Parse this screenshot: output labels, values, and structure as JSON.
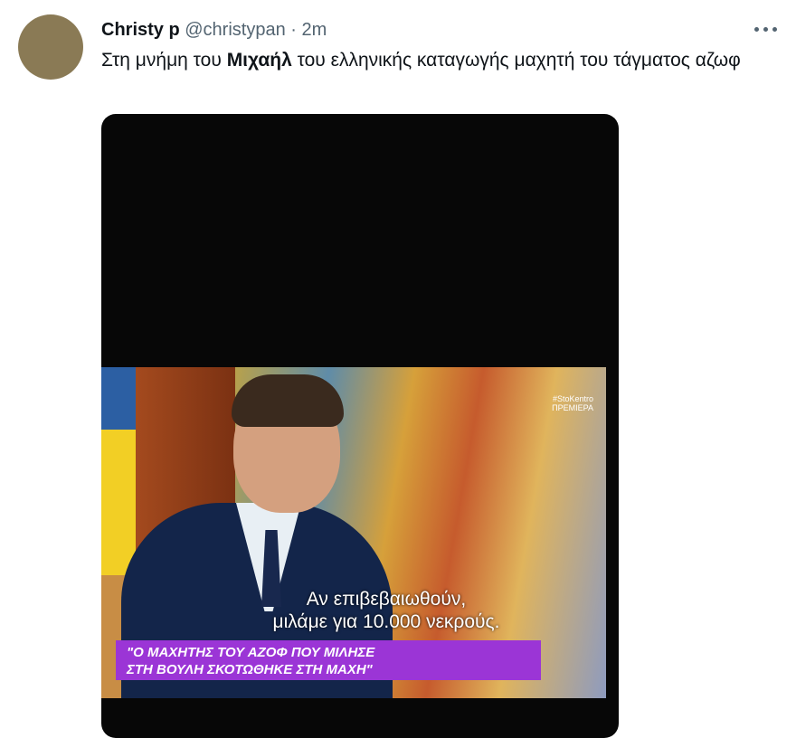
{
  "tweet": {
    "author_name": "Christy p",
    "handle": "@christypan",
    "separator": "·",
    "timestamp": "2m",
    "text_before": "Στη μνήμη του ",
    "text_bold": "Μιχαήλ",
    "text_after": " του ελληνικής καταγωγής μαχητή του τάγματος αζωφ"
  },
  "media": {
    "subtitle_line1": "Αν επιβεβαιωθούν,",
    "subtitle_line2": "μιλάμε για 10.000 νεκρούς.",
    "banner_line1": "\"Ο ΜΑΧΗΤΗΣ ΤΟΥ ΑΖΟΦ ΠΟΥ ΜΙΛΗΣΕ",
    "banner_line2": "ΣΤΗ ΒΟΥΛΗ ΣΚΟΤΩΘΗΚΕ ΣΤΗ ΜΑΧΗ\"",
    "logo_line1": "#StoKentro",
    "logo_line2": "ΠΡΕΜΙΕΡΑ"
  },
  "icons": {
    "more": "more-horizontal-icon"
  }
}
